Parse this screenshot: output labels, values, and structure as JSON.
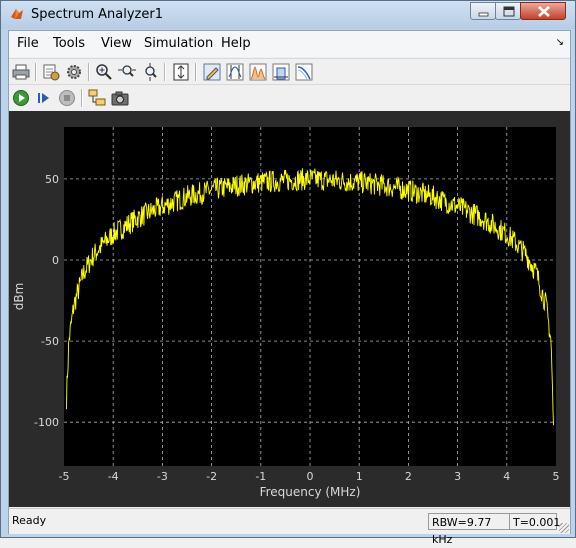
{
  "window": {
    "title": "Spectrum Analyzer1",
    "minimize_icon": "minimize-icon",
    "maximize_icon": "maximize-icon",
    "close_icon": "close-icon"
  },
  "menu": {
    "items": [
      "File",
      "Tools",
      "View",
      "Simulation",
      "Help"
    ]
  },
  "toolbar": {
    "row1_icons": [
      "print-icon",
      "spectrum-settings-icon",
      "gear-icon",
      "zoom-in-icon",
      "zoom-x-icon",
      "zoom-y-icon",
      "autoscale-icon",
      "edit-measurement-icon",
      "cursor-measurement-icon",
      "peak-finder-icon",
      "channel-measurement-icon",
      "distortion-icon"
    ],
    "row2_icons": [
      "run-icon",
      "step-forward-icon",
      "stop-icon",
      "highlight-block-icon",
      "snapshot-icon"
    ]
  },
  "chart_data": {
    "type": "line",
    "xlabel": "Frequency (MHz)",
    "ylabel": "dBm",
    "xlim": [
      -5,
      5
    ],
    "ylim": [
      -127,
      82
    ],
    "xticks": [
      "-5",
      "-4",
      "-3",
      "-2",
      "-1",
      "0",
      "1",
      "2",
      "3",
      "4",
      "5"
    ],
    "yticks": [
      "50",
      "0",
      "-50",
      "-100"
    ],
    "grid": true,
    "colors": {
      "background": "#000000",
      "trace": "#ffff00",
      "grid": "#b0b0b0",
      "axis_text": "#d8d8d8",
      "frame": "#2b2b2b"
    },
    "series": [
      {
        "x": [
          -4.95,
          -4.9,
          -4.8,
          -4.6,
          -4.4,
          -4.2,
          -4.0,
          -3.5,
          -3.0,
          -2.5,
          -2.0,
          -1.5,
          -1.0,
          -0.5,
          0.0,
          0.5,
          1.0,
          1.5,
          2.0,
          2.5,
          3.0,
          3.5,
          4.0,
          4.2,
          4.4,
          4.6,
          4.8,
          4.9,
          4.95
        ],
        "values": [
          -85,
          -50,
          -28,
          -8,
          3,
          10,
          16,
          26,
          33,
          39,
          43,
          46,
          48,
          49,
          50,
          49,
          48,
          46,
          43,
          39,
          33,
          26,
          16,
          10,
          3,
          -8,
          -28,
          -50,
          -105
        ]
      }
    ]
  },
  "status": {
    "ready": "Ready",
    "rbw": "RBW=9.77 kHz",
    "time": "T=0.001"
  }
}
